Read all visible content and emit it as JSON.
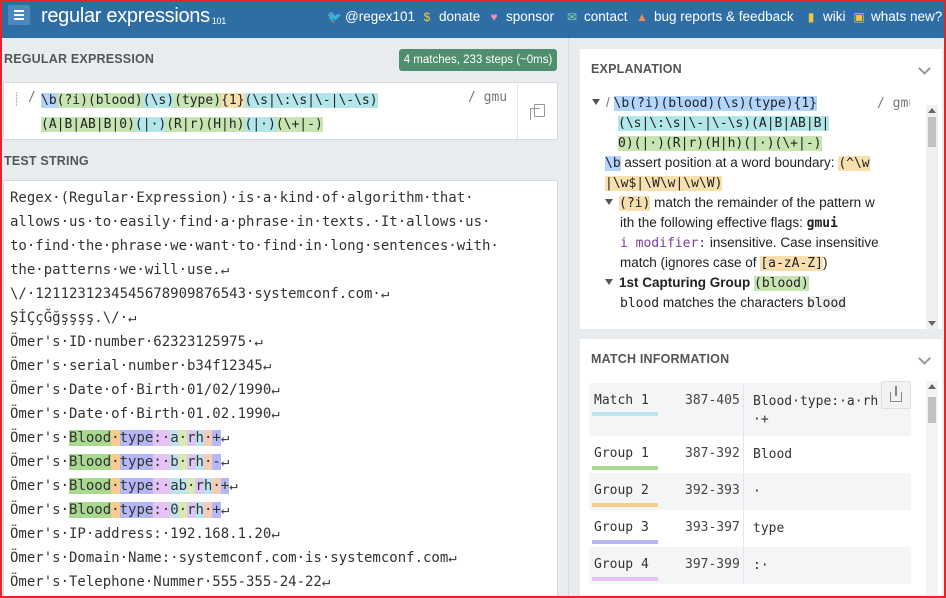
{
  "header": {
    "menu_icon": "hamburger-icon",
    "brand": "regular expressions",
    "brand_sub": "101",
    "nav": [
      {
        "label": "@regex101",
        "icon": "twitter-icon",
        "glyph": "🐦",
        "color": "#cfe3f5"
      },
      {
        "label": "donate",
        "icon": "dollar-icon",
        "glyph": "$",
        "color": "#f4c542"
      },
      {
        "label": "sponsor",
        "icon": "heart-icon",
        "glyph": "♥",
        "color": "#f08dc0"
      },
      {
        "label": "contact",
        "icon": "envelope-icon",
        "glyph": "✉",
        "color": "#8fd19e"
      },
      {
        "label": "bug reports & feedback",
        "icon": "warning-icon",
        "glyph": "▲",
        "color": "#f08a4b"
      },
      {
        "label": "wiki",
        "icon": "book-icon",
        "glyph": "▮",
        "color": "#f4c542"
      },
      {
        "label": "whats new?",
        "icon": "news-icon",
        "glyph": "▣",
        "color": "#f4c542"
      }
    ]
  },
  "regex": {
    "title": "REGULAR EXPRESSION",
    "badge": "4 matches, 233 steps (~0ms)",
    "delimiter": "/",
    "flags": "/ gmu",
    "line1": [
      {
        "t": "\\b",
        "c": "h-meta"
      },
      {
        "t": "(?i)",
        "c": "h-grp"
      },
      {
        "t": "(blood)",
        "c": "h-grp"
      },
      {
        "t": "(\\s)",
        "c": "h-esc"
      },
      {
        "t": "(type)",
        "c": "h-grp"
      },
      {
        "t": "{1}",
        "c": "h-q"
      },
      {
        "t": "(\\s|\\:\\s|\\-|\\-\\s)",
        "c": "h-esc"
      }
    ],
    "line2": [
      {
        "t": "(A|B|AB|B|0)",
        "c": "h-grp"
      },
      {
        "t": "(|·)",
        "c": "h-esc"
      },
      {
        "t": "(R|r)",
        "c": "h-grp"
      },
      {
        "t": "(H|h)",
        "c": "h-grp"
      },
      {
        "t": "(|·)",
        "c": "h-esc"
      },
      {
        "t": "(\\+|-)",
        "c": "h-grp"
      }
    ]
  },
  "test_string": {
    "title": "TEST STRING",
    "lines": [
      [
        {
          "t": "Regex·(Regular·Expression)·is·a·kind·of·algorithm·that·"
        }
      ],
      [
        {
          "t": "allows·us·to·easily·find·a·phrase·in·texts.·It·allows·us·"
        }
      ],
      [
        {
          "t": "to·find·the·phrase·we·want·to·find·in·long·sentences·with·"
        }
      ],
      [
        {
          "t": "the·patterns·we·will·use.↵"
        }
      ],
      [
        {
          "t": "\\/·121123123454567890987654​3·systemconf.com·↵"
        }
      ],
      [
        {
          "t": "ŞİÇçĞğşşşş.\\/·↵"
        }
      ],
      [
        {
          "t": "Ömer's·ID·number·62323125975·↵"
        }
      ],
      [
        {
          "t": "Ömer's·serial·number·b34f12345↵"
        }
      ],
      [
        {
          "t": "Ömer's·Date·of·Birth·01/02/1990↵"
        }
      ],
      [
        {
          "t": "Ömer's·Date·of·Birth·01.02.1990↵"
        }
      ],
      [
        {
          "t": "Ömer's·"
        },
        {
          "t": "Blood",
          "c": "m-g1"
        },
        {
          "t": "·",
          "c": "m-g2"
        },
        {
          "t": "type",
          "c": "m-g3"
        },
        {
          "t": ":·",
          "c": "m-g4"
        },
        {
          "t": "a",
          "c": "m-g5"
        },
        {
          "t": "·",
          "c": "m-g6"
        },
        {
          "t": "r",
          "c": "m-g7"
        },
        {
          "t": "h",
          "c": "m-g5"
        },
        {
          "t": "·",
          "c": "m-g8"
        },
        {
          "t": "+",
          "c": "m-g3"
        },
        {
          "t": "↵"
        }
      ],
      [
        {
          "t": "Ömer's·"
        },
        {
          "t": "Blood",
          "c": "m-g1"
        },
        {
          "t": "·",
          "c": "m-g2"
        },
        {
          "t": "type",
          "c": "m-g3"
        },
        {
          "t": ":·",
          "c": "m-g4"
        },
        {
          "t": "b",
          "c": "m-g5"
        },
        {
          "t": "·",
          "c": "m-g6"
        },
        {
          "t": "r",
          "c": "m-g7"
        },
        {
          "t": "h",
          "c": "m-g5"
        },
        {
          "t": "·",
          "c": "m-g8"
        },
        {
          "t": "-",
          "c": "m-g3"
        },
        {
          "t": "↵"
        }
      ],
      [
        {
          "t": "Ömer's·"
        },
        {
          "t": "Blood",
          "c": "m-g1"
        },
        {
          "t": "·",
          "c": "m-g2"
        },
        {
          "t": "type",
          "c": "m-g3"
        },
        {
          "t": ":·",
          "c": "m-g4"
        },
        {
          "t": "ab",
          "c": "m-g5"
        },
        {
          "t": "·",
          "c": "m-g6"
        },
        {
          "t": "r",
          "c": "m-g7"
        },
        {
          "t": "h",
          "c": "m-g5"
        },
        {
          "t": "·",
          "c": "m-g8"
        },
        {
          "t": "+",
          "c": "m-g3"
        },
        {
          "t": "↵"
        }
      ],
      [
        {
          "t": "Ömer's·"
        },
        {
          "t": "Blood",
          "c": "m-g1"
        },
        {
          "t": "·",
          "c": "m-g2"
        },
        {
          "t": "type",
          "c": "m-g3"
        },
        {
          "t": ":·",
          "c": "m-g4"
        },
        {
          "t": "0",
          "c": "m-g5"
        },
        {
          "t": "·",
          "c": "m-g6"
        },
        {
          "t": "r",
          "c": "m-g7"
        },
        {
          "t": "h",
          "c": "m-g5"
        },
        {
          "t": "·",
          "c": "m-g8"
        },
        {
          "t": "+",
          "c": "m-g3"
        },
        {
          "t": "↵"
        }
      ],
      [
        {
          "t": "Ömer's·IP·address:·192.168.1.20↵"
        }
      ],
      [
        {
          "t": "Ömer's·Domain·Name:·systemconf.com·is·systemconf.com↵"
        }
      ],
      [
        {
          "t": "Ömer's·Telephone·Nummer·555-355-24-22↵"
        }
      ]
    ]
  },
  "explanation": {
    "title": "EXPLANATION",
    "regex_line1": "\\b(?i)(blood)(\\s)(type){1}",
    "flags": "/ gmu",
    "regex_line2": "(\\s|\\:\\s|\\-|\\-\\s)(A|B|AB|B|",
    "regex_line3": "0)(|·)(R|r)(H|h)(|·)(\\+|-)",
    "b_token": "\\b",
    "b_text": "assert position at a word boundary:",
    "b_pattern1": "(^\\w",
    "b_pattern2": "|\\w$|\\W\\w|\\w\\W)",
    "qi_token": "(?i)",
    "qi_text": "match the remainder of the pattern w",
    "qi_text2": "ith the following effective flags:",
    "qi_flags": "gmui",
    "imod_token": "i modifier:",
    "imod_text": "insensitive. Case insensitive",
    "imod_text2": "match (ignores case of",
    "imod_range": "[a-zA-Z]",
    "imod_close": ")",
    "cg_label": "1st Capturing Group",
    "cg_token": "(blood)",
    "cg_text_token": "blood",
    "cg_text": "matches the characters",
    "cg_text_lit": "blood"
  },
  "match_info": {
    "title": "MATCH INFORMATION",
    "rows": [
      {
        "name": "Match 1",
        "range": "387-405",
        "value": "Blood·type:·a·rh\n·+",
        "underline": "#bde3f0"
      },
      {
        "name": "Group 1",
        "range": "387-392",
        "value": "Blood",
        "underline": "#a9d88f"
      },
      {
        "name": "Group 2",
        "range": "392-393",
        "value": "·",
        "underline": "#f6cd8c"
      },
      {
        "name": "Group 3",
        "range": "393-397",
        "value": "type",
        "underline": "#b6b8f6"
      },
      {
        "name": "Group 4",
        "range": "397-399",
        "value": ":·",
        "underline": "#e7c2f5"
      }
    ]
  }
}
